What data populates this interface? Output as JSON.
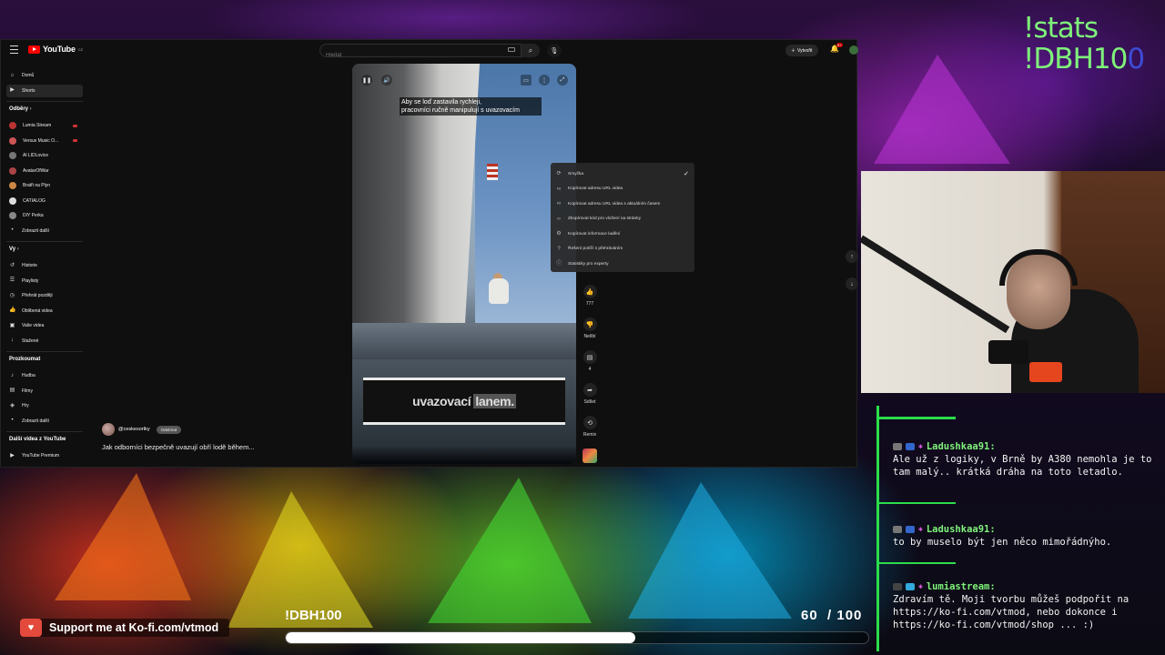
{
  "overlay": {
    "command_1": "!stats",
    "command_2_main": "!DBH10",
    "command_2_dim": "0",
    "kofi_text": "Support me at Ko-fi.com/vtmod",
    "goal_label": "!DBH100",
    "goal_current": "60",
    "goal_total": "/ 100",
    "goal_progress": 0.6,
    "accent": "#7ff27a",
    "chat_accent": "#2bdd4a"
  },
  "youtube": {
    "logo_text": "YouTube",
    "logo_region": "CZ",
    "search_placeholder": "Hledat",
    "create_label": "Vytvořit",
    "bell_badge": "9+",
    "sidebar": {
      "main": [
        {
          "label": "Domů",
          "icon": "home-icon"
        },
        {
          "label": "Shorts",
          "icon": "shorts-icon"
        }
      ],
      "subscriptions_header": "Odběry",
      "subscriptions": [
        {
          "label": "Lumia Stream",
          "color": "#b33",
          "live": true
        },
        {
          "label": "Versus Music O...",
          "color": "#c55",
          "live": true
        },
        {
          "label": "Al LIDLovice",
          "color": "#777",
          "live": false
        },
        {
          "label": "AvatarOfWar",
          "color": "#a44",
          "live": false
        },
        {
          "label": "Bratři na Plyn",
          "color": "#c84",
          "live": false
        },
        {
          "label": "CATIALOG",
          "color": "#ddd",
          "live": false
        },
        {
          "label": "DIY Perka",
          "color": "#888",
          "live": false
        }
      ],
      "show_more_1": "Zobrazit další",
      "you_header": "Vy",
      "you": [
        {
          "label": "Historie",
          "icon": "history-icon"
        },
        {
          "label": "Playlisty",
          "icon": "playlist-icon"
        },
        {
          "label": "Přehrát později",
          "icon": "watch-later-icon"
        },
        {
          "label": "Oblíbená videa",
          "icon": "like-icon"
        },
        {
          "label": "Vaše videa",
          "icon": "your-videos-icon"
        },
        {
          "label": "Stažené",
          "icon": "download-icon"
        }
      ],
      "explore_header": "Prozkoumat",
      "explore": [
        {
          "label": "Hudba",
          "icon": "music-icon"
        },
        {
          "label": "Filmy",
          "icon": "film-icon"
        },
        {
          "label": "Hry",
          "icon": "games-icon"
        }
      ],
      "show_more_2": "Zobrazit další",
      "more_header": "Další videa z YouTube",
      "more": [
        {
          "label": "YouTube Premium",
          "icon": "premium-icon"
        }
      ]
    },
    "video": {
      "caption_line1": "Aby se loď zastavila rychleji,",
      "caption_line2": "pracovníci ručně manipulují s uvazovacím",
      "paper_text": "uvazovací",
      "paper_highlight": "lanem.",
      "channel": "@ceskesortky",
      "subscribe_label": "Odebírat",
      "title": "Jak odborníci bezpečně uvazují obří lodě během..."
    },
    "actions": [
      {
        "icon": "thumb-up-icon",
        "label": "777"
      },
      {
        "icon": "thumb-down-icon",
        "label": "Nelíbí"
      },
      {
        "icon": "comment-icon",
        "label": "4"
      },
      {
        "icon": "share-icon",
        "label": "Sdílet"
      },
      {
        "icon": "remix-icon",
        "label": "Remix"
      }
    ],
    "context_menu": [
      {
        "icon": "loop-icon",
        "label": "Smyčka",
        "checked": true
      },
      {
        "icon": "link-icon",
        "label": "Kopírovat adresu URL videa",
        "checked": false
      },
      {
        "icon": "link-icon",
        "label": "Kopírovat adresu URL videa s aktuálním časem",
        "checked": false
      },
      {
        "icon": "embed-icon",
        "label": "Zkopírovat kód pro vložení na stránky",
        "checked": false
      },
      {
        "icon": "debug-icon",
        "label": "Kopírovat informace ladění",
        "checked": false
      },
      {
        "icon": "help-icon",
        "label": "Řešení potíží s přehráváním",
        "checked": false
      },
      {
        "icon": "info-icon",
        "label": "Statistiky pro experty",
        "checked": false
      }
    ]
  },
  "chat": [
    {
      "user": "Ladushkaa91:",
      "text": "Ale už z logiky, v Brně by A380 nemohla je to tam malý.. krátká dráha na toto letadlo.",
      "name_color": "#7ff27a"
    },
    {
      "user": "Ladushkaa91:",
      "text": "to by muselo být jen něco mimořádnýho.",
      "name_color": "#7ff27a"
    },
    {
      "user": "lumiastream:",
      "text": "Zdravím tě. Moji tvorbu můžeš podpořit na https://ko-fi.com/vtmod, nebo dokonce i https://ko-fi.com/vtmod/shop ... :)",
      "name_color": "#7ff27a"
    }
  ]
}
